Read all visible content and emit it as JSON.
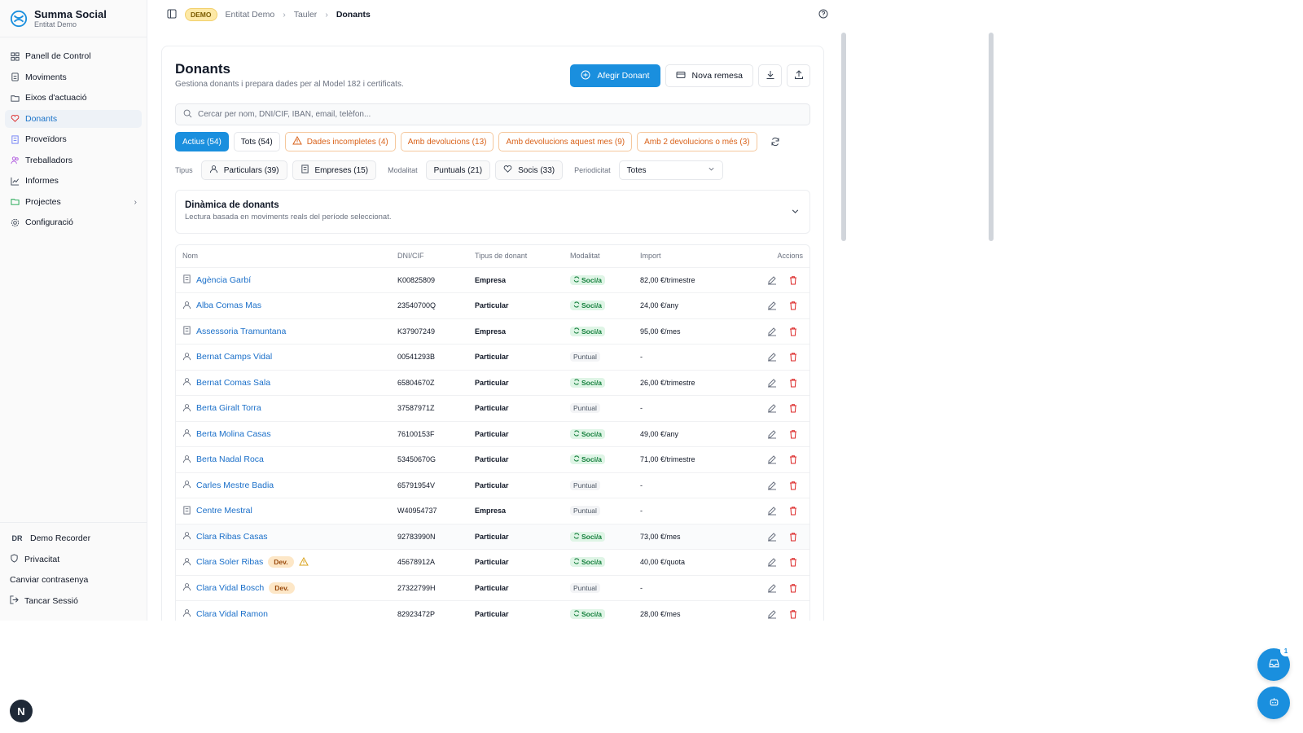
{
  "brand": {
    "name": "Summa Social",
    "entity": "Entitat Demo"
  },
  "sidebar": {
    "items": [
      {
        "label": "Panell de Control",
        "icon": "dashboard-icon"
      },
      {
        "label": "Moviments",
        "icon": "document-icon"
      },
      {
        "label": "Eixos d'actuació",
        "icon": "folder-icon"
      },
      {
        "label": "Donants",
        "icon": "heart-icon"
      },
      {
        "label": "Proveïdors",
        "icon": "building-icon"
      },
      {
        "label": "Treballadors",
        "icon": "users-icon"
      },
      {
        "label": "Informes",
        "icon": "chart-icon"
      },
      {
        "label": "Projectes",
        "icon": "folder-open-icon"
      },
      {
        "label": "Configuració",
        "icon": "gear-icon"
      }
    ],
    "active": "Donants",
    "user_initials": "DR",
    "user_name": "Demo Recorder",
    "privacy": "Privacitat",
    "change_password": "Canviar contrasenya",
    "logout": "Tancar Sessió"
  },
  "breadcrumb": {
    "badge": "DEMO",
    "entity": "Entitat Demo",
    "section": "Tauler",
    "current": "Donants"
  },
  "page": {
    "title": "Donants",
    "description": "Gestiona donants i prepara dades per al Model 182 i certificats.",
    "add_button": "Afegir Donant",
    "remittance_button": "Nova remesa",
    "search_placeholder": "Cercar per nom, DNI/CIF, IBAN, email, telèfon..."
  },
  "chips": [
    {
      "label": "Actius (54)"
    },
    {
      "label": "Tots (54)"
    },
    {
      "label": "Dades incompletes (4)"
    },
    {
      "label": "Amb devolucions (13)"
    },
    {
      "label": "Amb devolucions aquest mes (9)"
    },
    {
      "label": "Amb 2 devolucions o més (3)"
    }
  ],
  "filters": {
    "type_label": "Tipus",
    "particulars": "Particulars (39)",
    "companies": "Empreses (15)",
    "modality_label": "Modalitat",
    "punctual": "Puntuals (21)",
    "members": "Socis (33)",
    "periodicity_label": "Periodicitat",
    "periodicity_value": "Totes"
  },
  "dynamics": {
    "title": "Dinàmica de donants",
    "subtitle": "Lectura basada en moviments reals del període seleccionat."
  },
  "table": {
    "headers": {
      "name": "Nom",
      "id": "DNI/CIF",
      "type": "Tipus de donant",
      "modality": "Modalitat",
      "amount": "Import",
      "actions": "Accions"
    },
    "rows": [
      {
        "name": "Agència Garbí",
        "kind": "company",
        "id": "K00825809",
        "type": "Empresa",
        "modality": "Soci/a",
        "amount": "82,00 €/trimestre"
      },
      {
        "name": "Alba Comas Mas",
        "kind": "person",
        "id": "23540700Q",
        "type": "Particular",
        "modality": "Soci/a",
        "amount": "24,00 €/any"
      },
      {
        "name": "Assessoria Tramuntana",
        "kind": "company",
        "id": "K37907249",
        "type": "Empresa",
        "modality": "Soci/a",
        "amount": "95,00 €/mes"
      },
      {
        "name": "Bernat Camps Vidal",
        "kind": "person",
        "id": "00541293B",
        "type": "Particular",
        "modality": "Puntual",
        "amount": "-"
      },
      {
        "name": "Bernat Comas Sala",
        "kind": "person",
        "id": "65804670Z",
        "type": "Particular",
        "modality": "Soci/a",
        "amount": "26,00 €/trimestre"
      },
      {
        "name": "Berta Giralt Torra",
        "kind": "person",
        "id": "37587971Z",
        "type": "Particular",
        "modality": "Puntual",
        "amount": "-"
      },
      {
        "name": "Berta Molina Casas",
        "kind": "person",
        "id": "76100153F",
        "type": "Particular",
        "modality": "Soci/a",
        "amount": "49,00 €/any"
      },
      {
        "name": "Berta Nadal Roca",
        "kind": "person",
        "id": "53450670G",
        "type": "Particular",
        "modality": "Soci/a",
        "amount": "71,00 €/trimestre"
      },
      {
        "name": "Carles Mestre Badia",
        "kind": "person",
        "id": "65791954V",
        "type": "Particular",
        "modality": "Puntual",
        "amount": "-"
      },
      {
        "name": "Centre Mestral",
        "kind": "company",
        "id": "W40954737",
        "type": "Empresa",
        "modality": "Puntual",
        "amount": "-"
      },
      {
        "name": "Clara Ribas Casas",
        "kind": "person",
        "id": "92783990N",
        "type": "Particular",
        "modality": "Soci/a",
        "amount": "73,00 €/mes"
      },
      {
        "name": "Clara Soler Ribas",
        "kind": "person",
        "id": "45678912A",
        "type": "Particular",
        "modality": "Soci/a",
        "amount": "40,00 €/quota",
        "dev": "Dev.",
        "warning": true
      },
      {
        "name": "Clara Vidal Bosch",
        "kind": "person",
        "id": "27322799H",
        "type": "Particular",
        "modality": "Puntual",
        "amount": "-",
        "dev": "Dev."
      },
      {
        "name": "Clara Vidal Ramon",
        "kind": "person",
        "id": "82923472P",
        "type": "Particular",
        "modality": "Soci/a",
        "amount": "28,00 €/mes"
      }
    ]
  },
  "floating": {
    "inbox_count": "1",
    "n_button": "N"
  },
  "colors": {
    "primary": "#1a8fde",
    "link": "#1a6fc9",
    "warning": "#d9621a",
    "success": "#15803d",
    "danger": "#dc2626"
  }
}
